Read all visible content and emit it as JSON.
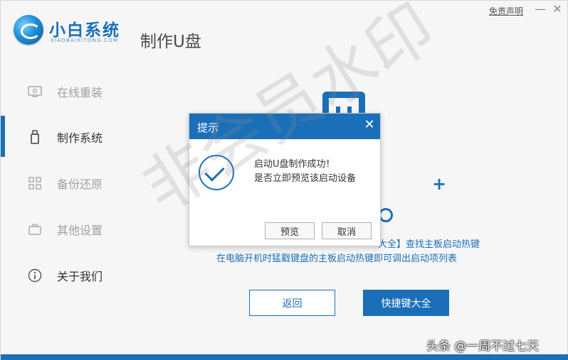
{
  "app": {
    "name": "小白系统",
    "subtitle": "XIAOBAIXITONG.COM",
    "page_title": "制作U盘",
    "disclaimer_link": "免责声明",
    "min_glyph": "—",
    "close_glyph": "✕"
  },
  "sidebar": {
    "items": [
      {
        "label": "在线重装",
        "icon": "monitor-icon"
      },
      {
        "label": "制作系统",
        "icon": "usb-drive-icon"
      },
      {
        "label": "备份还原",
        "icon": "backup-grid-icon"
      },
      {
        "label": "其他设置",
        "icon": "briefcase-icon"
      },
      {
        "label": "关于我们",
        "icon": "info-icon"
      }
    ],
    "active_index": 1
  },
  "main": {
    "hint_line1": "大全】查找主板启动热键",
    "hint_line2": "在电脑开机时猛戳键盘的主板启动热键即可调出启动项列表",
    "back_button": "返回",
    "hotkey_button": "快捷键大全",
    "plus_glyph": "+"
  },
  "dialog": {
    "title": "提示",
    "message_line1": "启动U盘制作成功！",
    "message_line2": "是否立即预览该启动设备",
    "preview_button": "预览",
    "cancel_button": "取消",
    "close_glyph": "✕"
  },
  "overlay": {
    "watermark": "非会员水印",
    "credit": "头条 @一周不过七天"
  },
  "colors": {
    "accent": "#1a6fb8",
    "background": "#f6f6f6"
  }
}
